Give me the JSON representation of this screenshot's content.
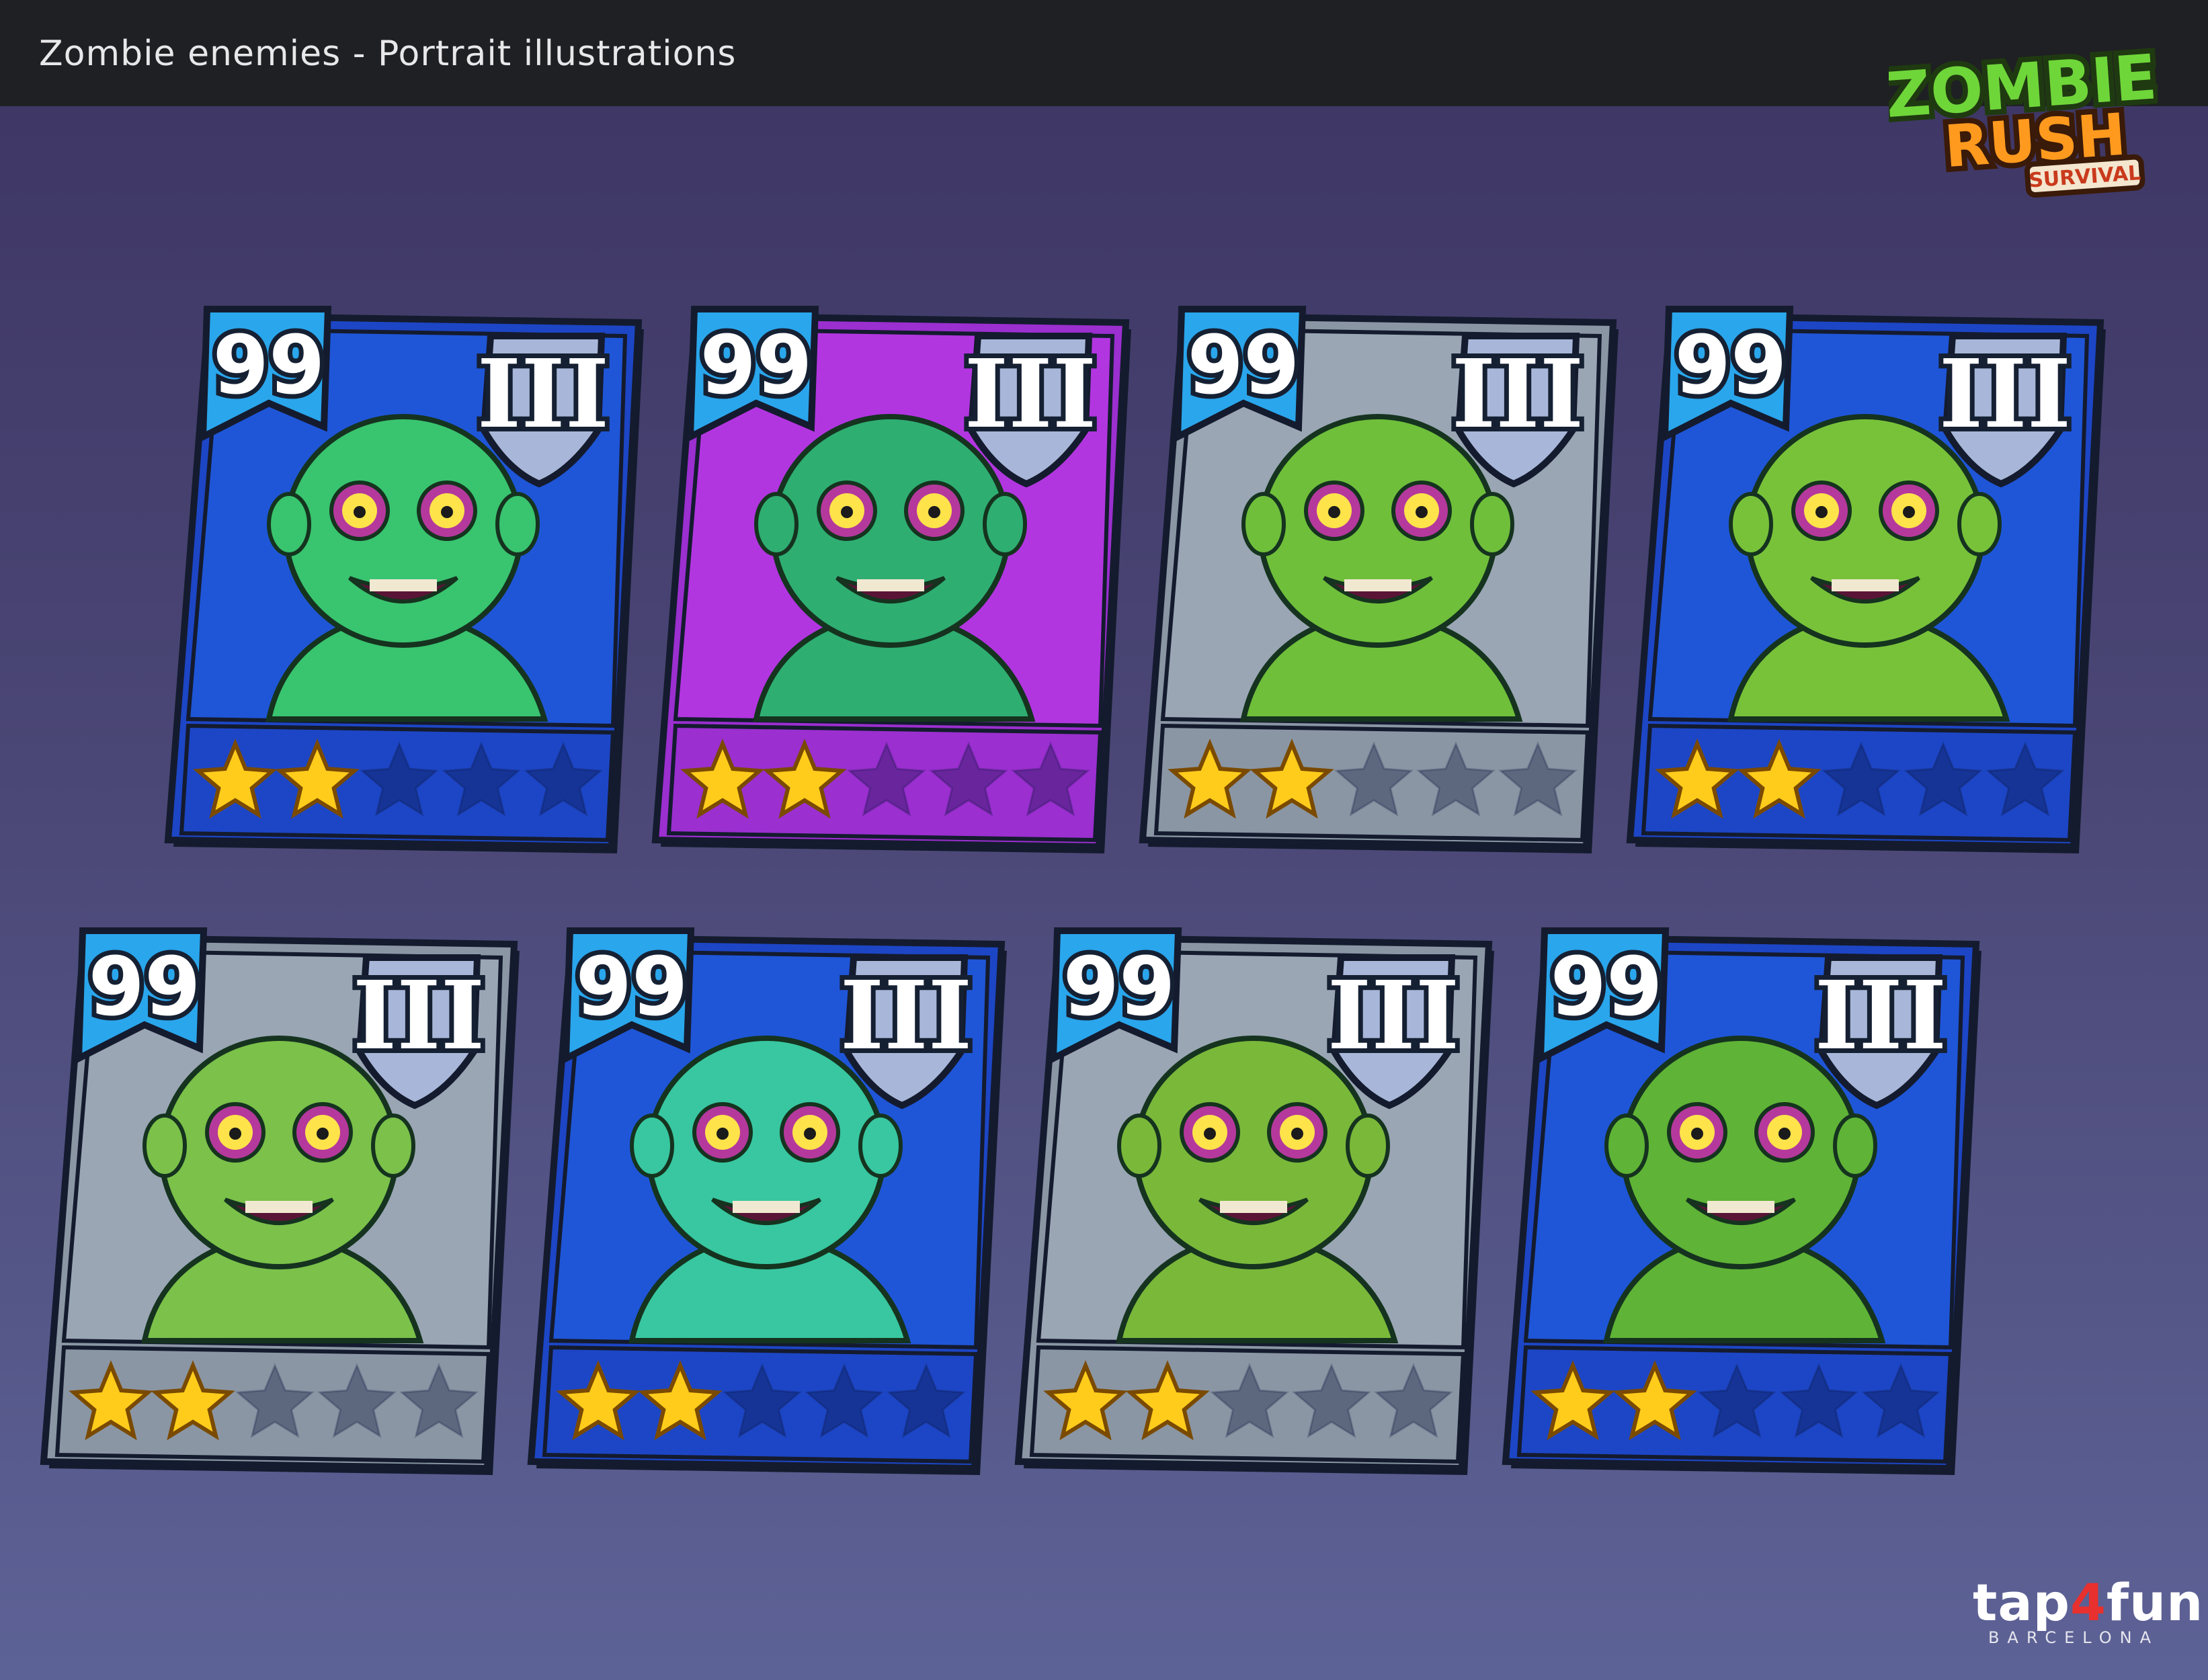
{
  "header": {
    "title": "Zombie enemies - Portrait illustrations"
  },
  "logo": {
    "line1": "ZOMBIE",
    "line2": "RUSH",
    "line3": "SURVIVAL"
  },
  "publisher": {
    "name_prefix": "tap",
    "name_accent": "4",
    "name_suffix": "fun",
    "city": "BARCELONA"
  },
  "cards": [
    {
      "name_icon": "frankenstein-zombie-portrait",
      "level": "99",
      "rank": "III",
      "stars_filled": 2,
      "stars_total": 5,
      "bg_color": "#1f56d8",
      "frame_color": "#1d46c6"
    },
    {
      "name_icon": "taxi-driver-zombie-portrait",
      "level": "99",
      "rank": "III",
      "stars_filled": 2,
      "stars_total": 5,
      "bg_color": "#b236e0",
      "frame_color": "#9b2fd0"
    },
    {
      "name_icon": "nerd-zombie-portrait",
      "level": "99",
      "rank": "III",
      "stars_filled": 2,
      "stars_total": 5,
      "bg_color": "#9aa6b4",
      "frame_color": "#8a96a4"
    },
    {
      "name_icon": "chain-brute-zombie-portrait",
      "level": "99",
      "rank": "III",
      "stars_filled": 2,
      "stars_total": 5,
      "bg_color": "#1f56d8",
      "frame_color": "#1d46c6"
    },
    {
      "name_icon": "old-man-zombie-portrait",
      "level": "99",
      "rank": "III",
      "stars_filled": 2,
      "stars_total": 5,
      "bg_color": "#9aa6b4",
      "frame_color": "#8a96a4"
    },
    {
      "name_icon": "nurse-zombie-portrait",
      "level": "99",
      "rank": "III",
      "stars_filled": 2,
      "stars_total": 5,
      "bg_color": "#1f56d8",
      "frame_color": "#1d46c6"
    },
    {
      "name_icon": "police-zombie-portrait",
      "level": "99",
      "rank": "III",
      "stars_filled": 2,
      "stars_total": 5,
      "bg_color": "#9aa6b4",
      "frame_color": "#8a96a4"
    },
    {
      "name_icon": "construction-worker-zombie-portrait",
      "level": "99",
      "rank": "III",
      "stars_filled": 2,
      "stars_total": 5,
      "bg_color": "#1f56d8",
      "frame_color": "#1d46c6"
    }
  ]
}
